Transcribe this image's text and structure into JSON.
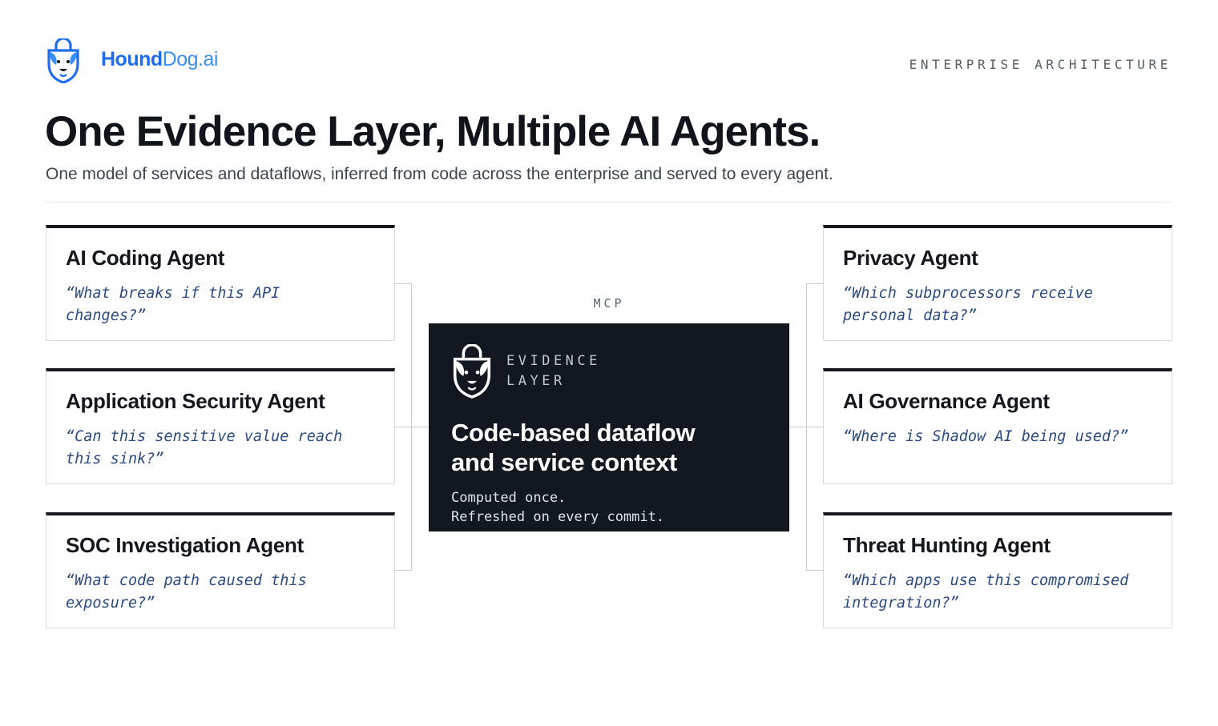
{
  "brand": {
    "part1": "Hound",
    "part2": "Dog.ai"
  },
  "kicker": "ENTERPRISE ARCHITECTURE",
  "title": "One Evidence Layer, Multiple AI Agents.",
  "subtitle": "One model of services and dataflows, inferred from code across the enterprise and served to every agent.",
  "hub": {
    "protocol": "MCP",
    "tag_line1": "EVIDENCE",
    "tag_line2": "LAYER",
    "title_line1": "Code-based dataflow",
    "title_line2": "and service context",
    "desc_line1": "Computed once.",
    "desc_line2": "Refreshed on every commit."
  },
  "agents_left": [
    {
      "name": "AI Coding Agent",
      "question": "“What breaks if this API changes?”"
    },
    {
      "name": "Application Security Agent",
      "question": "“Can this sensitive value reach this sink?”"
    },
    {
      "name": "SOC Investigation Agent",
      "question": "“What code path caused this exposure?”"
    }
  ],
  "agents_right": [
    {
      "name": "Privacy Agent",
      "question": "“Which subprocessors receive personal data?”"
    },
    {
      "name": "AI Governance Agent",
      "question": "“Where is Shadow AI being used?”"
    },
    {
      "name": "Threat Hunting Agent",
      "question": "“Which apps use this compromised integration?”"
    }
  ],
  "colors": {
    "brand_blue": "#1e6df0",
    "brand_light_blue": "#3a8ef6",
    "hub_bg": "#131820",
    "question_text": "#2b4a80"
  },
  "icons": {
    "logo": "hound-dog-shield-icon"
  }
}
